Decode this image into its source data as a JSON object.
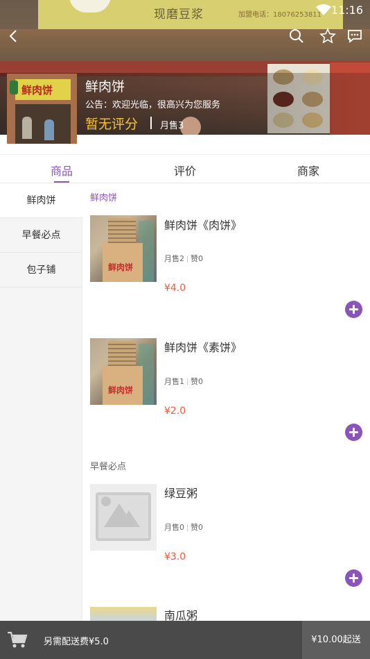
{
  "status_bar": {
    "time": "11:16"
  },
  "header_banner": {
    "sign_text": "现磨豆浆",
    "sign_phone": "加盟电话：18076253811",
    "thumb_sign": "鲜肉饼"
  },
  "shop": {
    "name": "鲜肉饼",
    "notice": "公告：欢迎光临，很高兴为您服务",
    "rating": "暂无评分",
    "monthly_sales": "月售3"
  },
  "tabs": [
    {
      "label": "商品"
    },
    {
      "label": "评价"
    },
    {
      "label": "商家"
    }
  ],
  "sidebar": {
    "items": [
      {
        "label": "鲜肉饼"
      },
      {
        "label": "早餐必点"
      },
      {
        "label": "包子铺"
      }
    ]
  },
  "sections": [
    {
      "title": "鲜肉饼",
      "products": [
        {
          "name": "鲜肉饼《肉饼》",
          "sales": "月售2",
          "likes": "赞0",
          "price": "¥4.0",
          "image_text": "鲜肉饼"
        },
        {
          "name": "鲜肉饼《素饼》",
          "sales": "月售1",
          "likes": "赞0",
          "price": "¥2.0",
          "image_text": "鲜肉饼"
        }
      ]
    },
    {
      "title": "早餐必点",
      "products": [
        {
          "name": "绿豆粥",
          "sales": "月售0",
          "likes": "赞0",
          "price": "¥3.0"
        },
        {
          "name": "南瓜粥"
        }
      ]
    }
  ],
  "cart": {
    "delivery_fee": "另需配送费¥5.0",
    "min_order": "¥10.00起送"
  },
  "colors": {
    "accent": "#8a55b8",
    "price": "#f0593a",
    "rating": "#f7c333",
    "cart_bar": "#4a4a4a"
  }
}
